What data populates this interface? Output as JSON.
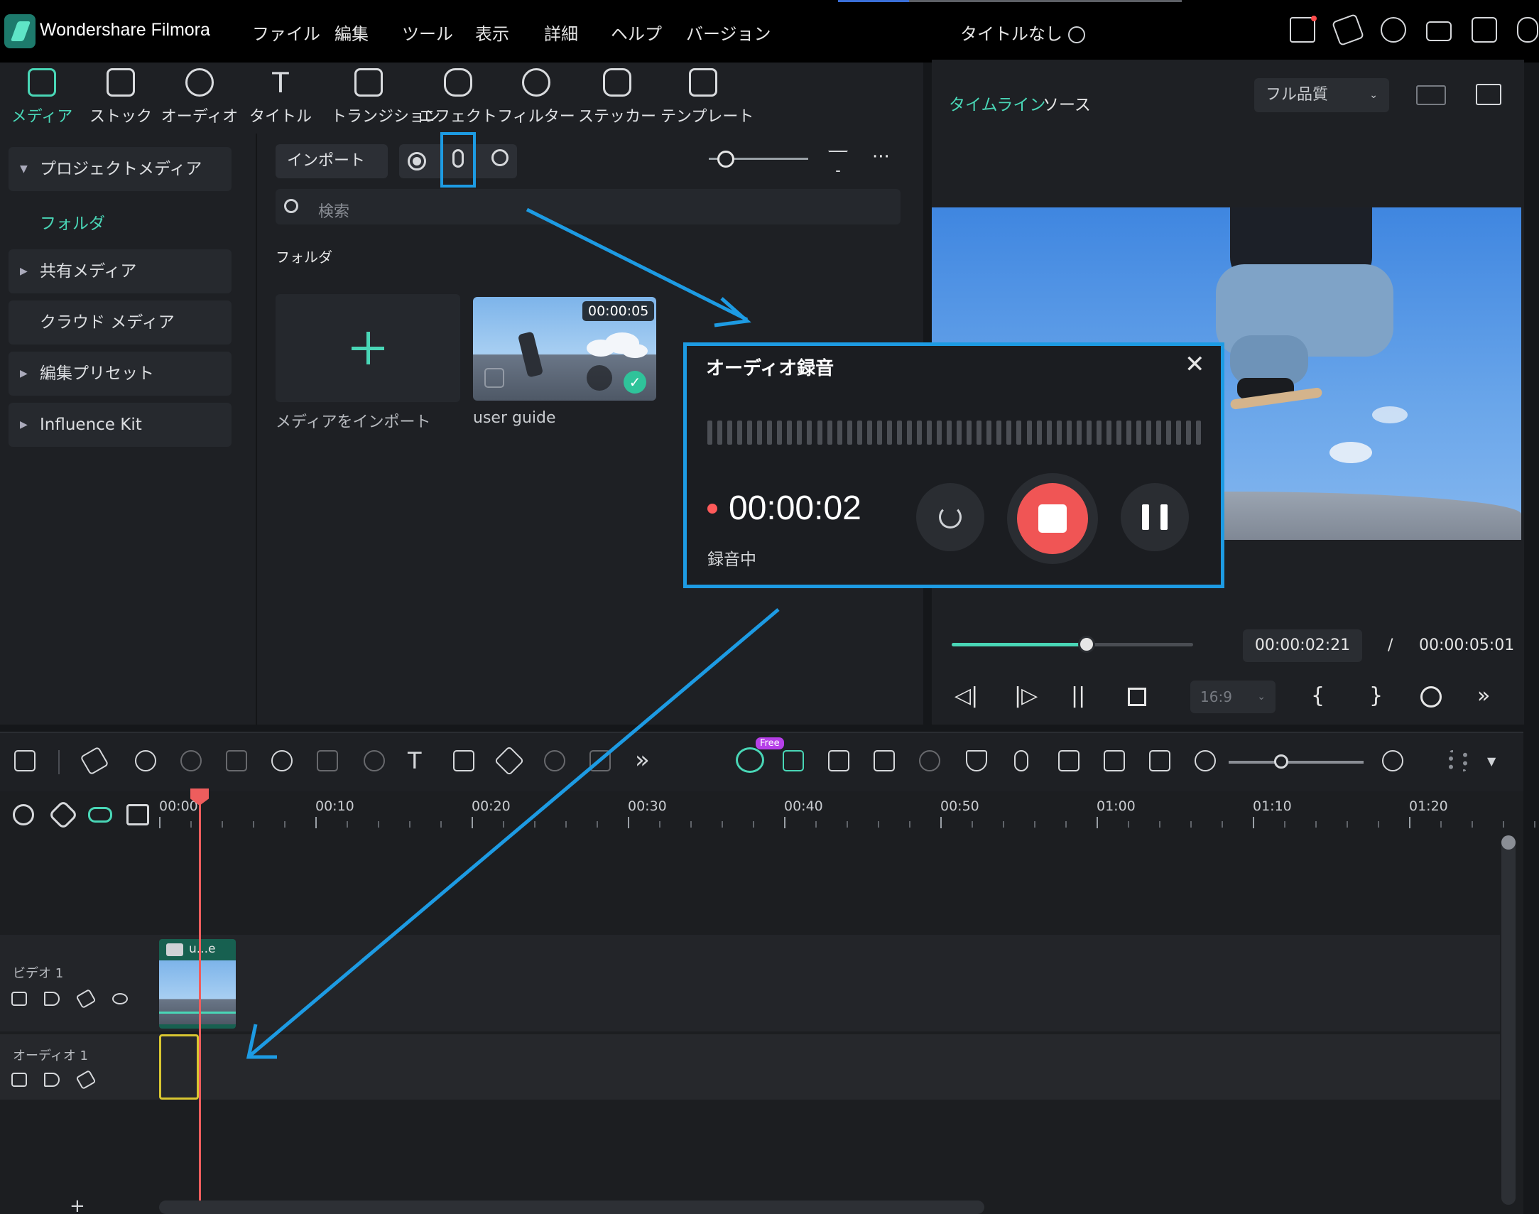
{
  "app": {
    "name": "Wondershare Filmora",
    "doc_title": "タイトルなし"
  },
  "menu": [
    "ファイル",
    "編集",
    "ツール",
    "表示",
    "詳細",
    "ヘルプ",
    "バージョン"
  ],
  "modules": [
    {
      "label": "メディア",
      "icon": "media-icon",
      "active": true
    },
    {
      "label": "ストック",
      "icon": "stock-icon"
    },
    {
      "label": "オーディオ",
      "icon": "music-note-icon"
    },
    {
      "label": "タイトル",
      "icon": "title-t-icon"
    },
    {
      "label": "トランジション",
      "icon": "transition-icon"
    },
    {
      "label": "エフェクト",
      "icon": "effect-star-icon"
    },
    {
      "label": "フィルター",
      "icon": "filter-icon"
    },
    {
      "label": "ステッカー",
      "icon": "sticker-icon"
    },
    {
      "label": "テンプレート",
      "icon": "template-icon"
    }
  ],
  "sidebar": {
    "project_media": "プロジェクトメディア",
    "folder": "フォルダ",
    "shared_media": "共有メディア",
    "cloud_media": "クラウド メディア",
    "edit_presets": "編集プリセット",
    "influence_kit": "Influence Kit"
  },
  "media": {
    "import_label": "インポート",
    "search_placeholder": "検索",
    "folder_heading": "フォルダ",
    "import_tile_label": "メディアをインポート",
    "clip_name": "user guide",
    "clip_duration": "00:00:05"
  },
  "preview": {
    "tab_timeline": "タイムライン",
    "tab_source": "ソース",
    "quality": "フル品質",
    "current_time": "00:00:02:21",
    "separator": "/",
    "total_time": "00:00:05:01",
    "aspect": "16:9",
    "progress": 0.56
  },
  "dialog": {
    "title": "オーディオ録音",
    "elapsed": "00:00:02",
    "status": "録音中"
  },
  "timeline": {
    "free_badge": "Free",
    "ruler": [
      "00:00",
      "00:10",
      "00:20",
      "00:30",
      "00:40",
      "00:50",
      "01:00",
      "01:10",
      "01:20"
    ],
    "tracks": {
      "video": "ビデオ 1",
      "audio": "オーディオ 1"
    },
    "clip_label": "u...e",
    "add_track": "+"
  },
  "colors": {
    "accent": "#49d6b6",
    "highlight": "#1d9be3",
    "record": "#f05555",
    "playhead": "#ee5d5d"
  }
}
